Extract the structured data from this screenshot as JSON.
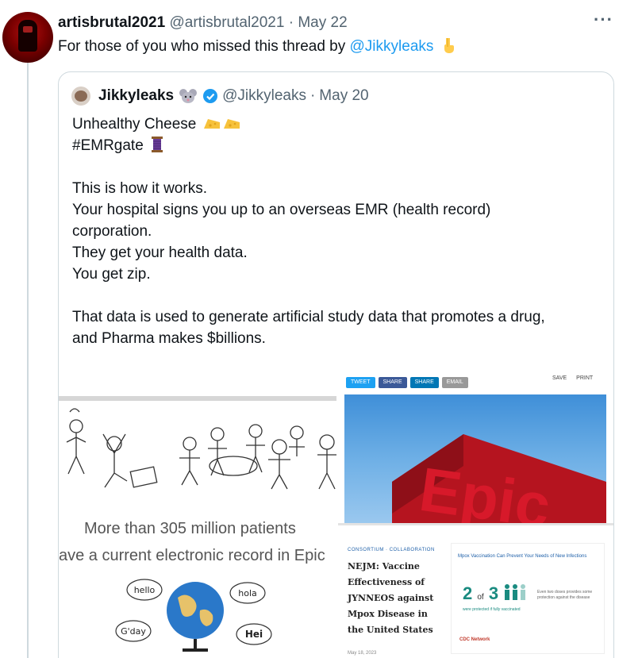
{
  "tweet": {
    "author_name": "artisbrutal2021",
    "author_handle": "@artisbrutal2021",
    "separator": "·",
    "date": "May 22",
    "more_label": "···",
    "text_before": "For those of you who missed this thread by ",
    "mention": "@Jikkyleaks"
  },
  "quote": {
    "author_name": "Jikkyleaks",
    "author_handle": "@Jikkyleaks",
    "separator": "·",
    "date": "May 20",
    "lines": {
      "l1": "Unhealthy Cheese",
      "l2": "#EMRgate",
      "l3": "This is how it works.",
      "l4": "Your hospital signs you up to an overseas EMR (health record)",
      "l5": "corporation.",
      "l6": "They get your health data.",
      "l7": "You get zip.",
      "l8": "That data is used to generate artificial study data that promotes a drug,",
      "l9": "and Pharma makes $billions."
    }
  },
  "media": {
    "left": {
      "stat_line1": "More than 305 million patients",
      "stat_line2": "ave a current electronic record in Epic",
      "bubbles": [
        "hello",
        "hola",
        "G'day",
        "Hei"
      ]
    },
    "right_top": {
      "share_buttons": [
        "TWEET",
        "SHARE",
        "SHARE",
        "EMAIL"
      ],
      "share_icons": [
        "SAVE",
        "PRINT"
      ],
      "sign_text": "Epic"
    },
    "right_bottom": {
      "kicker": "CONSORTIUM · COLLABORATION",
      "title": "NEJM: Vaccine Effectiveness of JYNNEOS against Mpox Disease in the United States",
      "date": "May 18, 2023",
      "infocard_title": "Mpox Vaccination Can Prevent Your Needs of New Infections",
      "big_num": "2",
      "big_of": "of",
      "big_den": "3",
      "desc": "were protected if fully vaccinated",
      "side_text": "Even two doses provides some protection against the disease",
      "logo": "CDC Network"
    }
  },
  "colors": {
    "link": "#1d9bf0",
    "secondary": "#536471",
    "border": "#cfd9de",
    "epic_red": "#d7192a",
    "teal": "#1a8b80"
  }
}
